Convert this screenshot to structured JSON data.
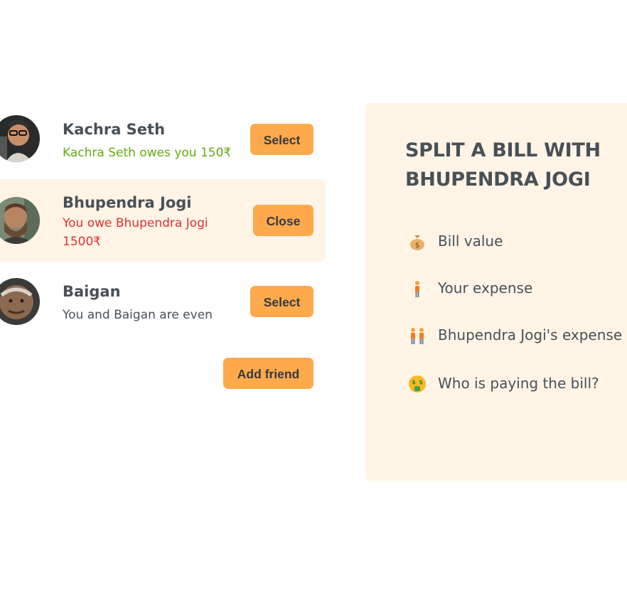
{
  "friends": [
    {
      "name": "Kachra Seth",
      "status": "Kachra Seth owes you 150₹",
      "status_tone": "positive",
      "button": "Select",
      "selected": false
    },
    {
      "name": "Bhupendra Jogi",
      "status": "You owe Bhupendra Jogi 1500₹",
      "status_tone": "negative",
      "button": "Close",
      "selected": true
    },
    {
      "name": "Baigan",
      "status": "You and Baigan are even",
      "status_tone": "neutral",
      "button": "Select",
      "selected": false
    }
  ],
  "add_friend_label": "Add friend",
  "split_form": {
    "title": "SPLIT A BILL WITH BHUPENDRA JOGI",
    "fields": [
      {
        "icon": "money-bag-icon",
        "label": "Bill value"
      },
      {
        "icon": "person-icon",
        "label": "Your expense"
      },
      {
        "icon": "two-people-icon",
        "label": "Bhupendra Jogi's expense"
      },
      {
        "icon": "money-face-icon",
        "label": "Who is paying the bill?"
      }
    ]
  },
  "colors": {
    "accent": "#ffa94d",
    "panel_bg": "#fff4e6",
    "positive": "#66a80f",
    "negative": "#e03131",
    "text": "#495057"
  }
}
